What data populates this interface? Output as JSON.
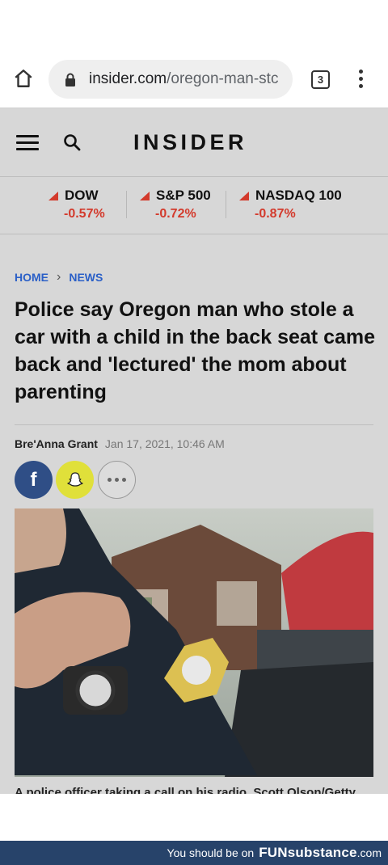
{
  "browser": {
    "url_host": "insider.com",
    "url_path": "/oregon-man-stc",
    "tab_count": "3"
  },
  "site": {
    "logo": "INSIDER"
  },
  "ticker": [
    {
      "name": "DOW",
      "change": "-0.57%"
    },
    {
      "name": "S&P 500",
      "change": "-0.72%"
    },
    {
      "name": "NASDAQ 100",
      "change": "-0.87%"
    }
  ],
  "breadcrumb": {
    "home": "HOME",
    "section": "NEWS"
  },
  "article": {
    "headline": "Police say Oregon man who stole a car with a child in the back seat came back and 'lectured' the mom about parenting",
    "author": "Bre'Anna Grant",
    "date": "Jan 17, 2021, 10:46 AM",
    "caption": "A police officer taking a call on his radio. Scott Olson/Getty"
  },
  "share": {
    "facebook_glyph": "f",
    "icons": [
      "facebook-icon",
      "snapchat-icon",
      "more-icon"
    ]
  },
  "colors": {
    "negative": "#d33a2c",
    "link": "#2a5fc7",
    "footer_bg": "#27436a"
  },
  "footer": {
    "prefix": "You should be on",
    "brand": "FUNsubstance",
    "tld": ".com"
  }
}
